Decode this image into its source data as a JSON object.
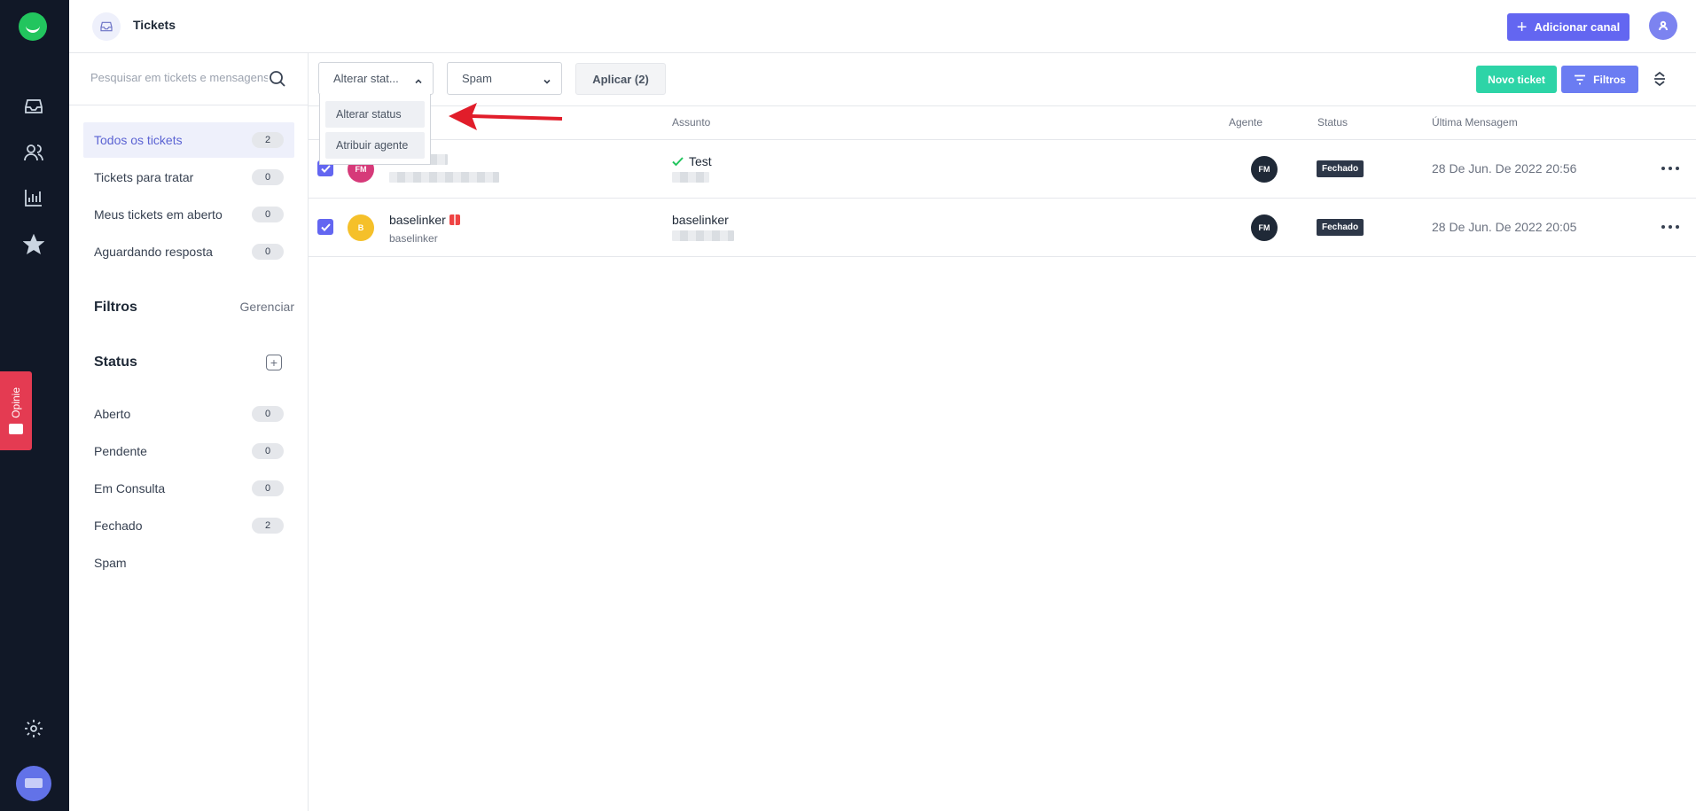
{
  "header": {
    "title": "Tickets",
    "add_channel_label": "Adicionar canal"
  },
  "rail": {
    "icons": [
      "inbox-icon",
      "contacts-icon",
      "reports-icon",
      "star-icon",
      "gear-icon"
    ],
    "feedback_label": "Opinie"
  },
  "sidebar": {
    "search_placeholder": "Pesquisar em tickets e mensagens",
    "items": [
      {
        "label": "Todos os tickets",
        "count": "2"
      },
      {
        "label": "Tickets para tratar",
        "count": "0"
      },
      {
        "label": "Meus tickets em aberto",
        "count": "0"
      },
      {
        "label": "Aguardando resposta",
        "count": "0"
      }
    ],
    "filters_title": "Filtros",
    "manage_label": "Gerenciar",
    "status_title": "Status",
    "statuses": [
      {
        "label": "Aberto",
        "count": "0"
      },
      {
        "label": "Pendente",
        "count": "0"
      },
      {
        "label": "Em Consulta",
        "count": "0"
      },
      {
        "label": "Fechado",
        "count": "2"
      },
      {
        "label": "Spam",
        "count": ""
      }
    ]
  },
  "toolbar": {
    "action_select_value": "Alterar stat...",
    "status_select_value": "Spam",
    "apply_label": "Aplicar (2)",
    "new_ticket_label": "Novo ticket",
    "filters_label": "Filtros"
  },
  "dropdown": {
    "options": [
      "Alterar status",
      "Atribuir agente"
    ]
  },
  "table": {
    "columns": {
      "subject": "Assunto",
      "agent": "Agente",
      "status": "Status",
      "last_message": "Última Mensagem"
    },
    "rows": [
      {
        "avatar": "FM",
        "avatar_color": "#d63a79",
        "name": "",
        "sub": "",
        "subject": "Test",
        "agent": "FM",
        "status": "Fechado",
        "date": "28 De Jun. De 2022 20:56"
      },
      {
        "avatar": "B",
        "avatar_color": "#f5c02a",
        "name": "baselinker",
        "sub": "baselinker",
        "subject": "baselinker",
        "agent": "FM",
        "status": "Fechado",
        "date": "28 De Jun. De 2022 20:05"
      }
    ]
  },
  "colors": {
    "accent": "#6366f1",
    "success": "#2dd4a7",
    "rail": "#111827",
    "feedback": "#e43b52"
  }
}
